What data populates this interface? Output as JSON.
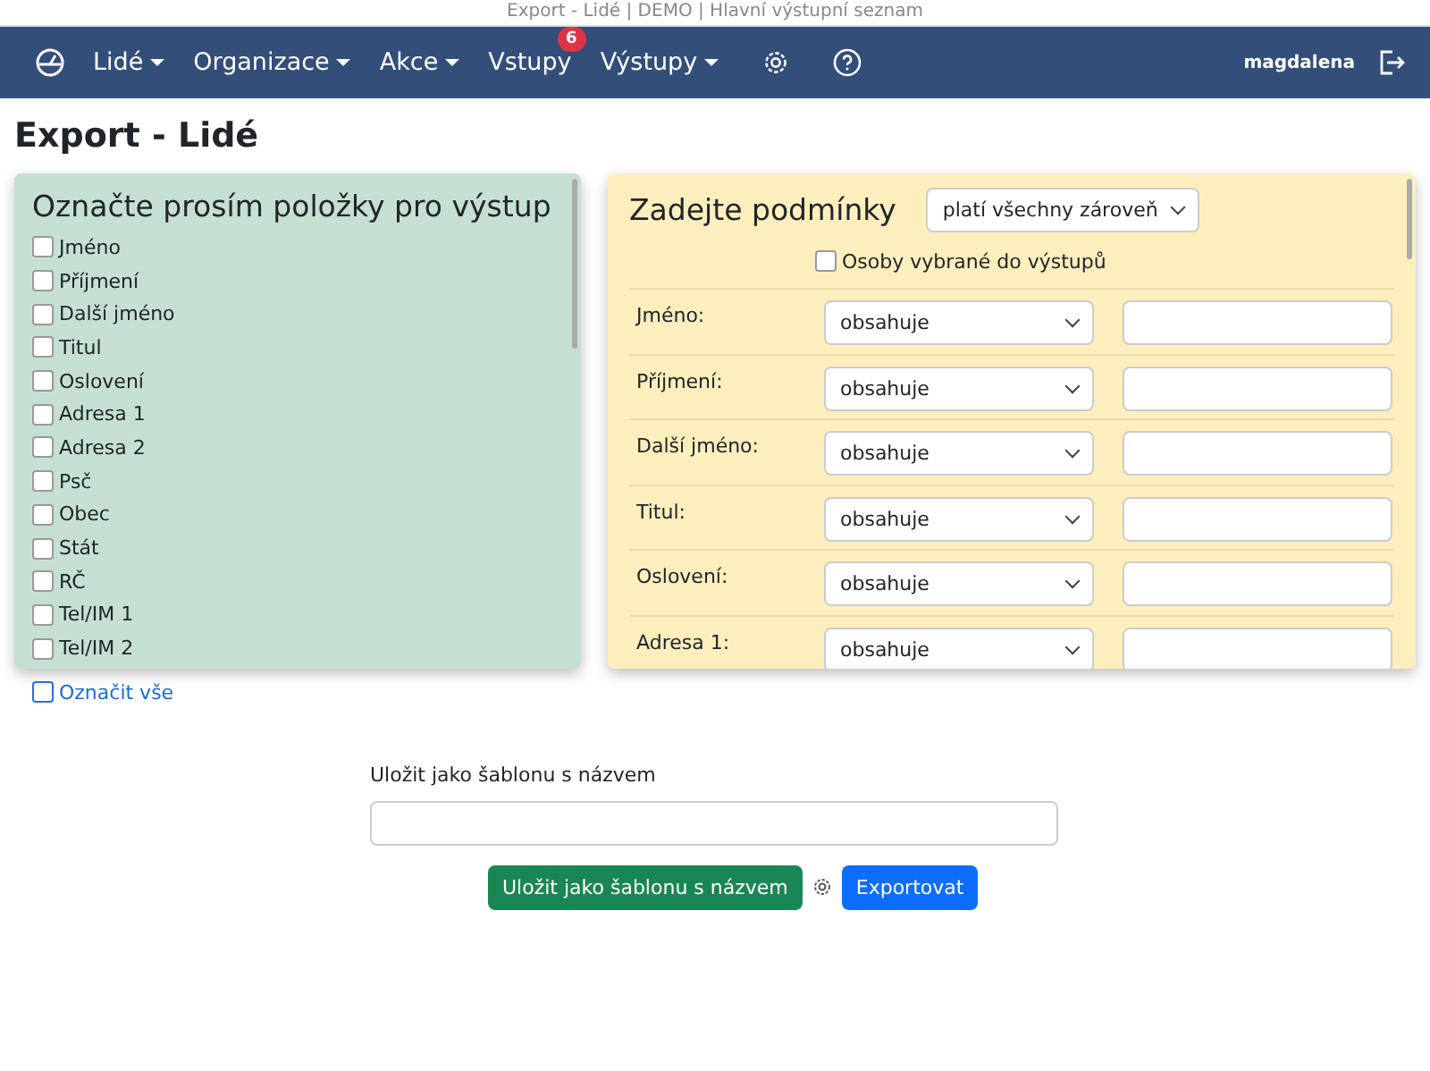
{
  "browser_title": "Export - Lidé | DEMO | Hlavní výstupní seznam",
  "navbar": {
    "items": [
      {
        "label": "Lidé",
        "dropdown": true
      },
      {
        "label": "Organizace",
        "dropdown": true
      },
      {
        "label": "Akce",
        "dropdown": true
      },
      {
        "label": "Vstupy",
        "dropdown": false,
        "badge": "6"
      },
      {
        "label": "Výstupy",
        "dropdown": true
      }
    ],
    "user": "magdalena"
  },
  "page_title": "Export - Lidé",
  "fields_panel": {
    "title": "Označte prosím položky pro výstup",
    "items": [
      {
        "label": "Jméno",
        "checked": false
      },
      {
        "label": "Příjmení",
        "checked": false
      },
      {
        "label": "Další jméno",
        "checked": false
      },
      {
        "label": "Titul",
        "checked": false
      },
      {
        "label": "Oslovení",
        "checked": false
      },
      {
        "label": "Adresa 1",
        "checked": false
      },
      {
        "label": "Adresa 2",
        "checked": false
      },
      {
        "label": "Psč",
        "checked": false
      },
      {
        "label": "Obec",
        "checked": false
      },
      {
        "label": "Stát",
        "checked": false
      },
      {
        "label": "RČ",
        "checked": false
      },
      {
        "label": "Tel/IM 1",
        "checked": false
      },
      {
        "label": "Tel/IM 2",
        "checked": false
      }
    ]
  },
  "select_all": {
    "label": "Označit vše",
    "checked": false
  },
  "conditions_panel": {
    "title": "Zadejte podmínky",
    "mode": "platí všechny zároveň",
    "selected_only": {
      "label": "Osoby vybrané do výstupů",
      "checked": false
    },
    "rows": [
      {
        "label": "Jméno:",
        "operator": "obsahuje"
      },
      {
        "label": "Příjmení:",
        "operator": "obsahuje"
      },
      {
        "label": "Další jméno:",
        "operator": "obsahuje"
      },
      {
        "label": "Titul:",
        "operator": "obsahuje"
      },
      {
        "label": "Oslovení:",
        "operator": "obsahuje"
      },
      {
        "label": "Adresa 1:",
        "operator": "obsahuje"
      }
    ]
  },
  "template": {
    "label": "Uložit jako šablonu s názvem"
  },
  "buttons": {
    "save": "Uložit jako šablonu s názvem",
    "export": "Exportovat"
  }
}
